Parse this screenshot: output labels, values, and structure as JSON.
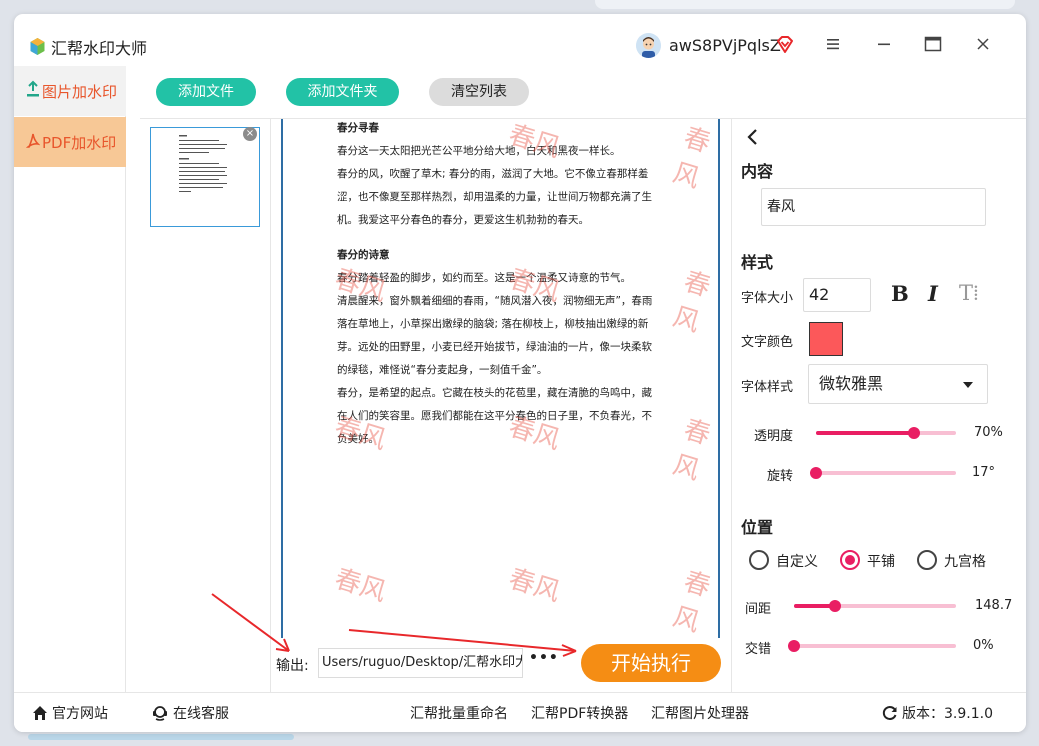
{
  "app": {
    "title": "汇帮水印大师",
    "username": "awS8PVjPqlsZ"
  },
  "nav": [
    {
      "label": "图片加水印",
      "icon": "image-upload-icon"
    },
    {
      "label": "PDF加水印",
      "icon": "pdf-icon"
    }
  ],
  "toolbar": {
    "add_file": "添加文件",
    "add_folder": "添加文件夹",
    "clear_list": "清空列表"
  },
  "document": {
    "heading1": "春分寻春",
    "para1": "春分这一天太阳把光芒公平地分给大地，白天和黑夜一样长。",
    "para2": "春分的风，吹醒了草木; 春分的雨，滋润了大地。它不像立春那样羞涩，也不像夏至那样热烈，却用温柔的力量，让世间万物都充满了生机。我爱这平分春色的春分，更爱这生机勃勃的春天。",
    "heading2": "春分的诗意",
    "para3": "春分踏着轻盈的脚步，如约而至。这是一个温柔又诗意的节气。",
    "para4": "清晨醒来，窗外飘着细细的春雨，“随风潜入夜，润物细无声”，春雨落在草地上，小草探出嫩绿的脑袋; 落在柳枝上，柳枝抽出嫩绿的新芽。远处的田野里，小麦已经开始拔节，绿油油的一片，像一块柔软的绿毯，难怪说“春分麦起身，一刻值千金”。",
    "para5": "春分，是希望的起点。它藏在枝头的花苞里，藏在清脆的鸟鸣中，藏在人们的笑容里。愿我们都能在这平分春色的日子里，不负春光，不负美好。"
  },
  "watermark": {
    "text": "春风"
  },
  "output": {
    "label": "输出:",
    "path": "Users/ruguo/Desktop/汇帮水印大师",
    "more": "•••",
    "start": "开始执行"
  },
  "panel": {
    "content_title": "内容",
    "content_value": "春风",
    "style_title": "样式",
    "font_size_label": "字体大小",
    "font_size": "42",
    "bold": "B",
    "italic": "I",
    "text_icon": "T⁞",
    "font_color_label": "文字颜色",
    "font_color": "#fc585a",
    "font_style_label": "字体样式",
    "font_style": "微软雅黑",
    "opacity_label": "透明度",
    "opacity_value": "70%",
    "opacity": 0.7,
    "rotate_label": "旋转",
    "rotate_value": "17°",
    "rotate_fraction": 0.0,
    "position_title": "位置",
    "radio_custom": "自定义",
    "radio_tile": "平铺",
    "radio_grid": "九宫格",
    "spacing_label": "间距",
    "spacing_value": "148.7",
    "spacing_fraction": 0.25,
    "stagger_label": "交错",
    "stagger_value": "0%",
    "stagger_fraction": 0.0
  },
  "footer": {
    "website": "官方网站",
    "support": "在线客服",
    "rename": "汇帮批量重命名",
    "pdf_converter": "汇帮PDF转换器",
    "image_processor": "汇帮图片处理器",
    "version": "版本：3.9.1.0"
  }
}
